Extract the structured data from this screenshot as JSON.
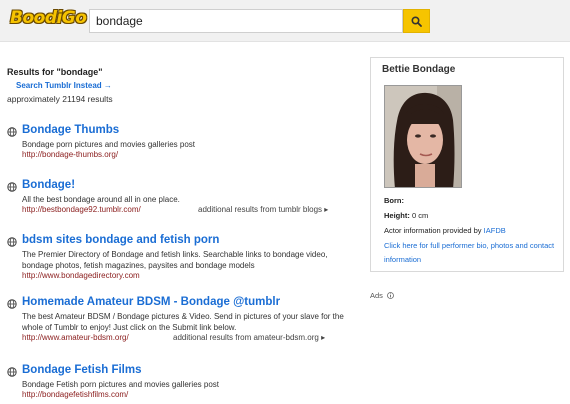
{
  "header": {
    "logo_text": "BoodiGo",
    "search_value": "bondage"
  },
  "results_meta": {
    "heading": "Results for \"bondage\"",
    "tumblr_link": "Search Tumblr Instead →",
    "count": "approximately 21194 results"
  },
  "results": [
    {
      "title": "Bondage Thumbs",
      "description": "Bondage porn pictures and movies galleries post",
      "url": "http://bondage-thumbs.org/",
      "extra": ""
    },
    {
      "title": "Bondage!",
      "description": "All the best bondage around all in one place.",
      "url": "http://bestbondage92.tumblr.com/",
      "extra": "additional results from tumblr blogs ▸"
    },
    {
      "title": "bdsm sites bondage and fetish porn",
      "description": "The Premier Directory of Bondage and fetish links. Searchable links to bondage video, bondage photos, fetish magazines, paysites and bondage models",
      "url": "http://www.bondagedirectory.com",
      "extra": ""
    },
    {
      "title": "Homemade Amateur BDSM - Bondage @tumblr",
      "description": "The best Amateur BDSM / Bondage pictures & Video. Send in pictures of your slave for the whole of Tumblr to enjoy! Just click on the Submit link below.",
      "url": "http://www.amateur-bdsm.org/",
      "extra": "additional results from amateur-bdsm.org ▸"
    },
    {
      "title": "Bondage Fetish Films",
      "description": "Bondage Fetish porn pictures and movies galleries post",
      "url": "http://bondagefetishfilms.com/",
      "extra": ""
    }
  ],
  "panel": {
    "name": "Bettie Bondage",
    "born_label": "Born:",
    "height_label": "Height:",
    "height_value": "0 cm",
    "provider_text": "Actor information provided by",
    "provider_link": "IAFDB",
    "more_line1": "Click here for full performer bio, photos and contact",
    "more_line2": "information"
  },
  "ads_label": "Ads",
  "colors": {
    "link_blue": "#1a6dd4",
    "url_red": "#8a1c1c",
    "accent_yellow": "#f6c400"
  }
}
